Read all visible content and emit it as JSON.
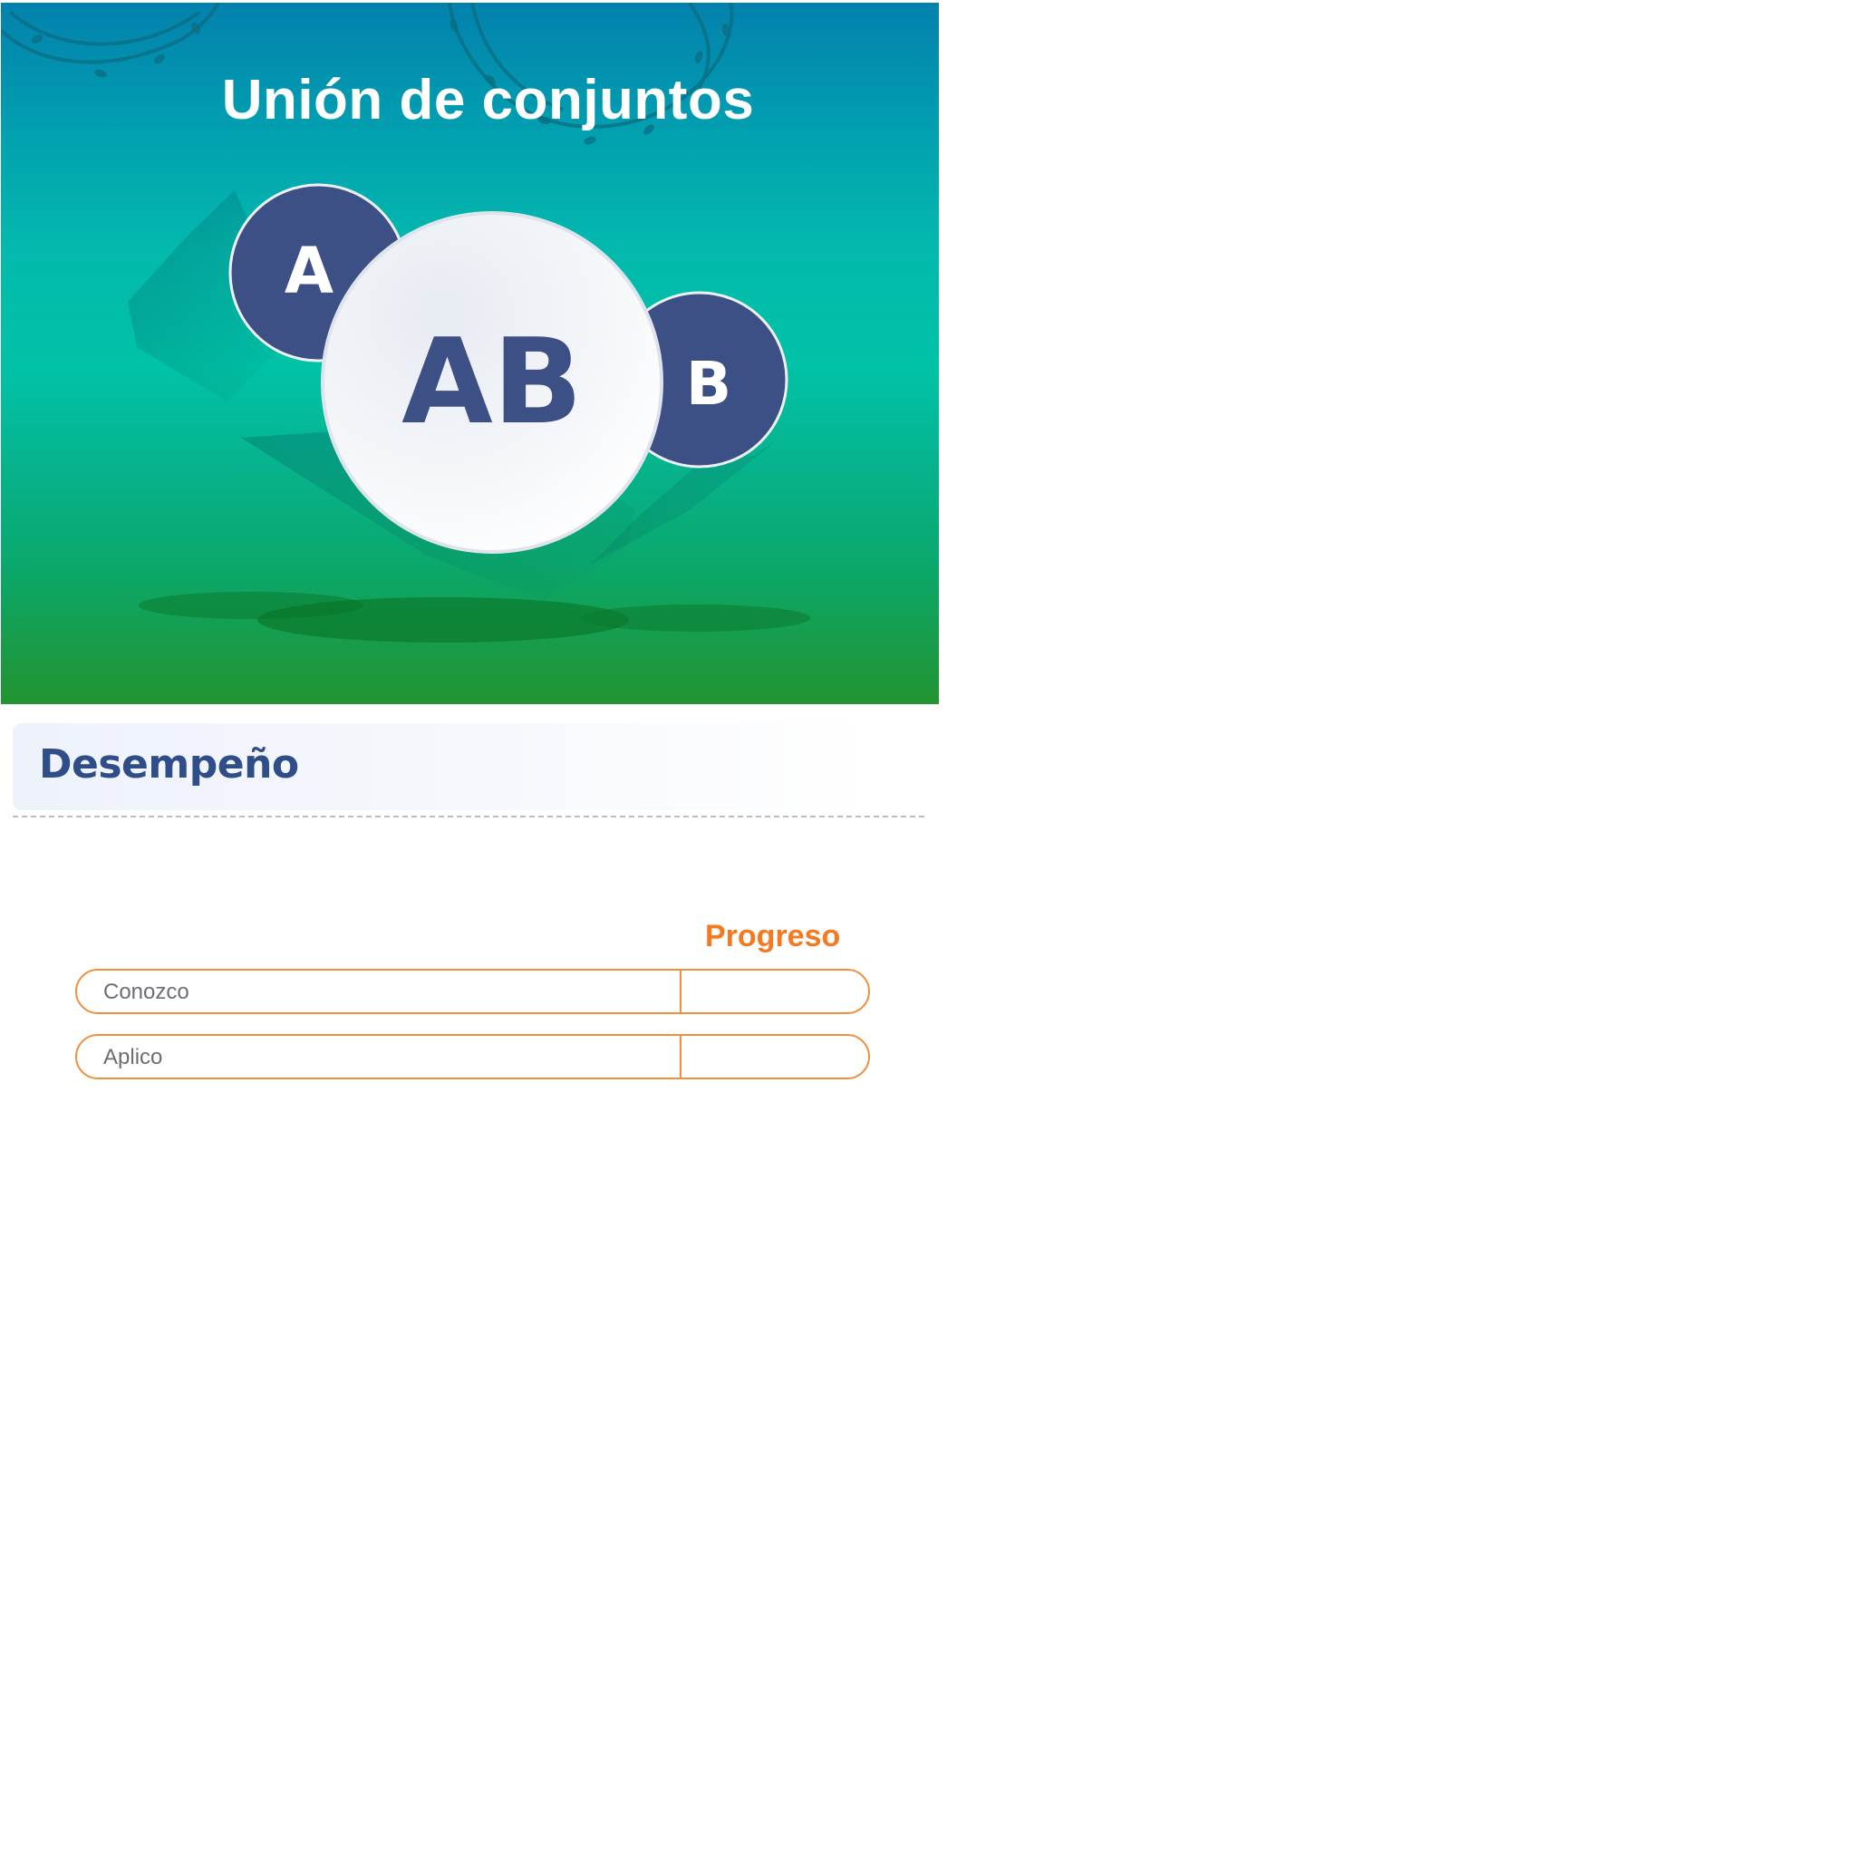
{
  "hero": {
    "title": "Unión de conjuntos",
    "circle_a_label": "A",
    "circle_union_label": "AB",
    "circle_b_label": "B",
    "colors": {
      "gradient_top": "#0381ad",
      "gradient_mid": "#00c2a6",
      "gradient_bottom": "#229431",
      "circle_dark": "#3d5085",
      "circle_light": "#eef1f6"
    }
  },
  "section": {
    "title": "Desempeño"
  },
  "progress": {
    "heading": "Progreso",
    "rows": [
      {
        "label": "Conozco",
        "value": ""
      },
      {
        "label": "Aplico",
        "value": ""
      }
    ],
    "accent_color": "#f47a22"
  }
}
